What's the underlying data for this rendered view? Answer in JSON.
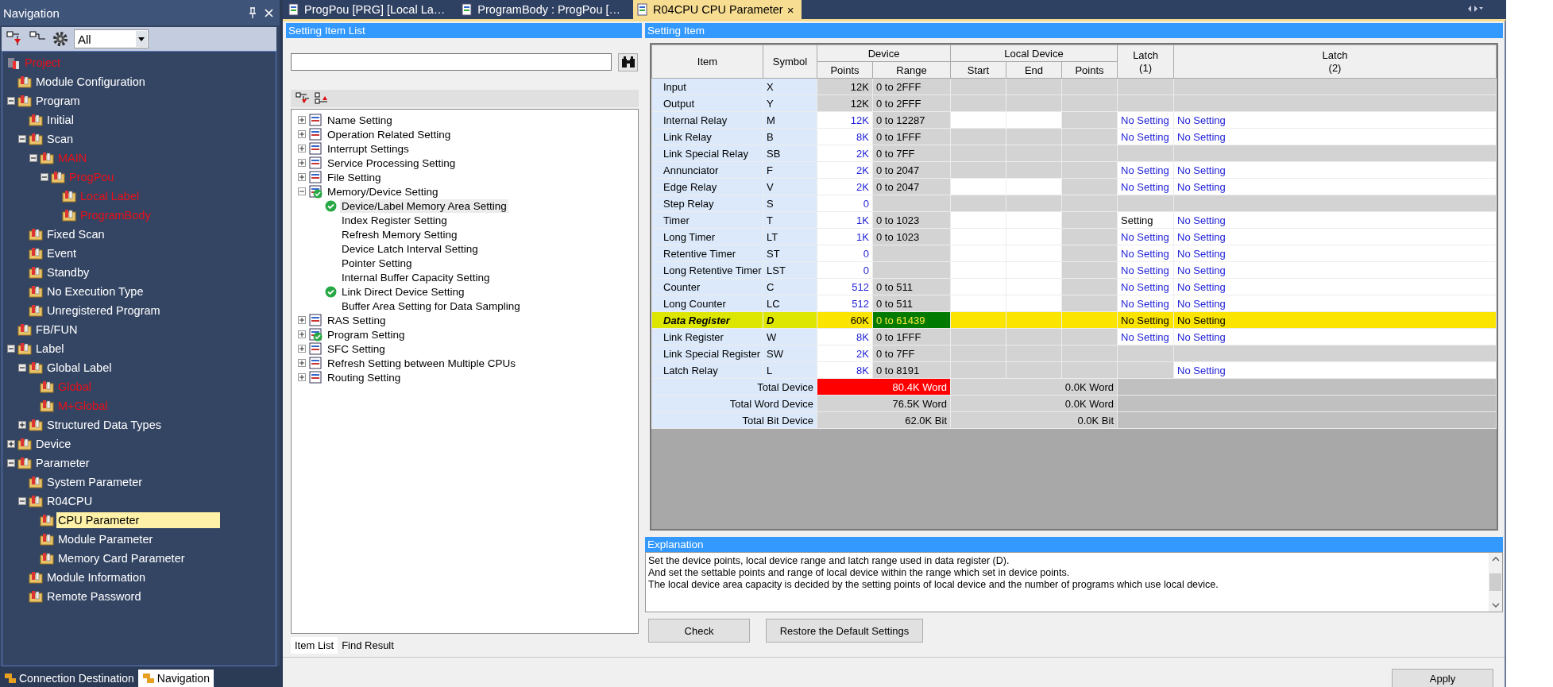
{
  "navigation": {
    "title": "Navigation",
    "filter": "All",
    "project": {
      "label": "Project",
      "unconverted": true
    },
    "tree": [
      {
        "label": "Module Configuration",
        "unconverted": false,
        "selected": false
      },
      {
        "label": "Program",
        "unconverted": false,
        "selected": false,
        "expanded": true,
        "children": [
          {
            "label": "Initial",
            "unconverted": false,
            "selected": false
          },
          {
            "label": "Scan",
            "unconverted": false,
            "selected": false,
            "expanded": true,
            "children": [
              {
                "label": "MAIN",
                "unconverted": true,
                "selected": false,
                "expanded": true,
                "children": [
                  {
                    "label": "ProgPou",
                    "unconverted": true,
                    "selected": false,
                    "expanded": true,
                    "children": [
                      {
                        "label": "Local Label",
                        "unconverted": true,
                        "selected": false
                      },
                      {
                        "label": "ProgramBody",
                        "unconverted": true,
                        "selected": false
                      }
                    ]
                  }
                ]
              }
            ]
          },
          {
            "label": "Fixed Scan",
            "unconverted": false,
            "selected": false
          },
          {
            "label": "Event",
            "unconverted": false,
            "selected": false
          },
          {
            "label": "Standby",
            "unconverted": false,
            "selected": false
          },
          {
            "label": "No Execution Type",
            "unconverted": false,
            "selected": false
          },
          {
            "label": "Unregistered Program",
            "unconverted": false,
            "selected": false
          }
        ]
      },
      {
        "label": "FB/FUN",
        "unconverted": false,
        "selected": false
      },
      {
        "label": "Label",
        "unconverted": false,
        "selected": false,
        "expanded": true,
        "children": [
          {
            "label": "Global Label",
            "unconverted": false,
            "selected": false,
            "expanded": true,
            "children": [
              {
                "label": "Global",
                "unconverted": true,
                "selected": false
              },
              {
                "label": "M+Global",
                "unconverted": true,
                "selected": false
              }
            ]
          },
          {
            "label": "Structured Data Types",
            "unconverted": false,
            "selected": false,
            "expanded": false
          }
        ]
      },
      {
        "label": "Device",
        "unconverted": false,
        "selected": false,
        "expanded": false
      },
      {
        "label": "Parameter",
        "unconverted": false,
        "selected": false,
        "expanded": true,
        "children": [
          {
            "label": "System Parameter",
            "unconverted": false,
            "selected": false
          },
          {
            "label": "R04CPU",
            "unconverted": false,
            "selected": false,
            "expanded": true,
            "children": [
              {
                "label": "CPU Parameter",
                "unconverted": false,
                "selected": true
              },
              {
                "label": "Module Parameter",
                "unconverted": false,
                "selected": false
              },
              {
                "label": "Memory Card Parameter",
                "unconverted": false,
                "selected": false
              }
            ]
          },
          {
            "label": "Module Information",
            "unconverted": false,
            "selected": false
          },
          {
            "label": "Remote Password",
            "unconverted": false,
            "selected": false
          }
        ]
      }
    ],
    "bottom_tabs": [
      {
        "label": "Connection Destination",
        "selected": false
      },
      {
        "label": "Navigation",
        "selected": true
      }
    ]
  },
  "editor_tabs": [
    {
      "label": "ProgPou [PRG] [Local La…",
      "selected": false
    },
    {
      "label": "ProgramBody : ProgPou […",
      "selected": false
    },
    {
      "label": "R04CPU CPU Parameter",
      "selected": true,
      "close": "×"
    }
  ],
  "setting_item_list": {
    "title": "Setting Item List",
    "tree": [
      {
        "label": "Name Setting",
        "expanded": false,
        "checked": false,
        "selected": false
      },
      {
        "label": "Operation Related Setting",
        "expanded": false,
        "checked": false,
        "selected": false
      },
      {
        "label": "Interrupt Settings",
        "expanded": false,
        "checked": false,
        "selected": false
      },
      {
        "label": "Service Processing Setting",
        "expanded": false,
        "checked": false,
        "selected": false
      },
      {
        "label": "File Setting",
        "expanded": false,
        "checked": false,
        "selected": false
      },
      {
        "label": "Memory/Device Setting",
        "expanded": true,
        "checked": true,
        "selected": false,
        "children": [
          {
            "label": "Device/Label Memory Area Setting",
            "checked": true,
            "selected": true
          },
          {
            "label": "Index Register Setting",
            "checked": false,
            "selected": false
          },
          {
            "label": "Refresh Memory Setting",
            "checked": false,
            "selected": false
          },
          {
            "label": "Device Latch Interval Setting",
            "checked": false,
            "selected": false
          },
          {
            "label": "Pointer Setting",
            "checked": false,
            "selected": false
          },
          {
            "label": "Internal Buffer Capacity Setting",
            "checked": false,
            "selected": false
          },
          {
            "label": "Link Direct Device Setting",
            "checked": true,
            "selected": false
          },
          {
            "label": "Buffer Area Setting for Data Sampling",
            "checked": false,
            "selected": false
          }
        ]
      },
      {
        "label": "RAS Setting",
        "expanded": false,
        "checked": false,
        "selected": false
      },
      {
        "label": "Program Setting",
        "expanded": false,
        "checked": true,
        "selected": false
      },
      {
        "label": "SFC Setting",
        "expanded": false,
        "checked": false,
        "selected": false
      },
      {
        "label": "Refresh Setting between Multiple CPUs",
        "expanded": false,
        "checked": false,
        "selected": false
      },
      {
        "label": "Routing Setting",
        "expanded": false,
        "checked": false,
        "selected": false
      }
    ],
    "tabs": [
      {
        "label": "Item List",
        "selected": true
      },
      {
        "label": "Find Result",
        "selected": false
      }
    ]
  },
  "setting_item": {
    "title": "Setting Item",
    "headers": {
      "item": "Item",
      "symbol": "Symbol",
      "device": "Device",
      "points": "Points",
      "range": "Range",
      "local_device": "Local Device",
      "start": "Start",
      "end": "End",
      "local_points": "Points",
      "latch_1": "Latch\n(1)",
      "latch_2": "Latch\n(2)"
    },
    "rows": [
      {
        "item": "Input",
        "symbol": "X",
        "points": "12K",
        "range": "0 to 2FFF",
        "points_editable": false,
        "local_editable": false,
        "selected": false
      },
      {
        "item": "Output",
        "symbol": "Y",
        "points": "12K",
        "range": "0 to 2FFF",
        "points_editable": false,
        "local_editable": false,
        "selected": false
      },
      {
        "item": "Internal Relay",
        "symbol": "M",
        "points": "12K",
        "range": "0 to 12287",
        "points_editable": true,
        "local_editable": true,
        "selected": false,
        "latch_1": "No Setting",
        "latch_1_default": true,
        "latch_2": "No Setting"
      },
      {
        "item": "Link Relay",
        "symbol": "B",
        "points": "8K",
        "range": "0 to 1FFF",
        "points_editable": true,
        "local_editable": false,
        "selected": false,
        "latch_1": "No Setting",
        "latch_1_default": true,
        "latch_2": "No Setting"
      },
      {
        "item": "Link Special Relay",
        "symbol": "SB",
        "points": "2K",
        "range": "0 to 7FF",
        "points_editable": true,
        "local_editable": false,
        "selected": false
      },
      {
        "item": "Annunciator",
        "symbol": "F",
        "points": "2K",
        "range": "0 to 2047",
        "points_editable": true,
        "local_editable": false,
        "selected": false,
        "latch_1": "No Setting",
        "latch_1_default": true,
        "latch_2": "No Setting"
      },
      {
        "item": "Edge Relay",
        "symbol": "V",
        "points": "2K",
        "range": "0 to 2047",
        "points_editable": true,
        "local_editable": true,
        "selected": false,
        "latch_1": "No Setting",
        "latch_1_default": true,
        "latch_2": "No Setting"
      },
      {
        "item": "Step Relay",
        "symbol": "S",
        "points": "0",
        "points_editable": true,
        "local_editable": false,
        "selected": false
      },
      {
        "item": "Timer",
        "symbol": "T",
        "points": "1K",
        "range": "0 to 1023",
        "points_editable": true,
        "local_editable": true,
        "selected": false,
        "latch_1": "Setting",
        "latch_1_default": false,
        "latch_2": "No Setting"
      },
      {
        "item": "Long Timer",
        "symbol": "LT",
        "points": "1K",
        "range": "0 to 1023",
        "points_editable": true,
        "local_editable": true,
        "selected": false,
        "latch_1": "No Setting",
        "latch_1_default": true,
        "latch_2": "No Setting"
      },
      {
        "item": "Retentive Timer",
        "symbol": "ST",
        "points": "0",
        "points_editable": true,
        "local_editable": true,
        "selected": false,
        "latch_1": "No Setting",
        "latch_1_default": true,
        "latch_2": "No Setting"
      },
      {
        "item": "Long Retentive Timer",
        "symbol": "LST",
        "points": "0",
        "points_editable": true,
        "local_editable": true,
        "selected": false,
        "latch_1": "No Setting",
        "latch_1_default": true,
        "latch_2": "No Setting"
      },
      {
        "item": "Counter",
        "symbol": "C",
        "points": "512",
        "range": "0 to 511",
        "points_editable": true,
        "local_editable": true,
        "selected": false,
        "latch_1": "No Setting",
        "latch_1_default": true,
        "latch_2": "No Setting"
      },
      {
        "item": "Long Counter",
        "symbol": "LC",
        "points": "512",
        "range": "0 to 511",
        "points_editable": true,
        "local_editable": true,
        "selected": false,
        "latch_1": "No Setting",
        "latch_1_default": true,
        "latch_2": "No Setting"
      },
      {
        "item": "Data Register",
        "symbol": "D",
        "points": "60K",
        "range": "0 to 61439",
        "points_editable": true,
        "local_editable": true,
        "selected": true,
        "latch_1": "No Setting",
        "latch_1_default": true,
        "latch_2": "No Setting"
      },
      {
        "item": "Link Register",
        "symbol": "W",
        "points": "8K",
        "range": "0 to 1FFF",
        "points_editable": true,
        "local_editable": false,
        "selected": false,
        "latch_1": "No Setting",
        "latch_1_default": true,
        "latch_2": "No Setting"
      },
      {
        "item": "Link Special Register",
        "symbol": "SW",
        "points": "2K",
        "range": "0 to 7FF",
        "points_editable": true,
        "local_editable": false,
        "selected": false
      },
      {
        "item": "Latch Relay",
        "symbol": "L",
        "points": "8K",
        "range": "0 to 8191",
        "points_editable": true,
        "local_editable": false,
        "selected": false,
        "latch_2": "No Setting"
      }
    ],
    "totals": [
      {
        "label": "Total Device",
        "device": "80.4K Word",
        "local": "0.0K Word",
        "over_limit": true
      },
      {
        "label": "Total Word Device",
        "device": "76.5K Word",
        "local": "0.0K Word",
        "over_limit": false
      },
      {
        "label": "Total Bit Device",
        "device": "62.0K Bit",
        "local": "0.0K Bit",
        "over_limit": false
      }
    ]
  },
  "explanation": {
    "title": "Explanation",
    "lines": [
      "Set the device points, local device range and latch range used in data register (D).",
      "And set the settable points and range of local device within the range which set in device points.",
      "The local device area capacity is decided by the setting points of local device and the number of programs which use local device."
    ]
  },
  "buttons": {
    "check": "Check",
    "restore": "Restore the Default Settings",
    "apply": "Apply"
  }
}
